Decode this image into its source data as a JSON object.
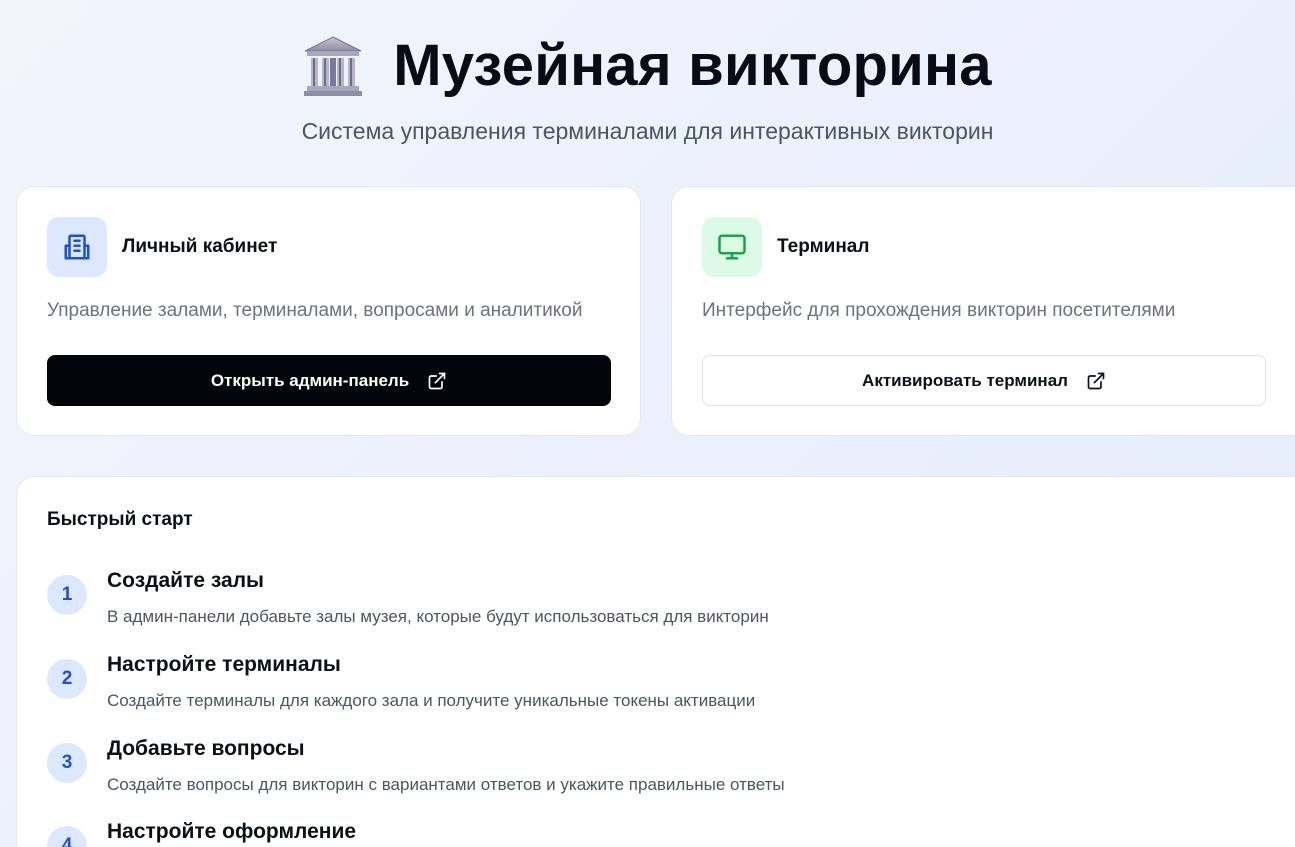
{
  "header": {
    "title": "Музейная викторина",
    "subtitle": "Система управления терминалами для интерактивных викторин",
    "icon": "museum-building-icon"
  },
  "cards": {
    "admin": {
      "icon": "building-document-icon",
      "title": "Личный кабинет",
      "description": "Управление залами, терминалами, вопросами и аналитикой",
      "button_label": "Открыть админ-панель",
      "button_icon": "external-link-icon",
      "accent": "#1d4fd8",
      "icon_bg": "#dbe8fd"
    },
    "terminal": {
      "icon": "monitor-icon",
      "title": "Терминал",
      "description": "Интерфейс для прохождения викторин посетителями",
      "button_label": "Активировать терминал",
      "button_icon": "external-link-icon",
      "accent": "#16a34a",
      "icon_bg": "#dcfbe6"
    }
  },
  "quick_start": {
    "title": "Быстрый старт",
    "steps": [
      {
        "number": "1",
        "title": "Создайте залы",
        "description": "В админ-панели добавьте залы музея, которые будут использоваться для викторин"
      },
      {
        "number": "2",
        "title": "Настройте терминалы",
        "description": "Создайте терминалы для каждого зала и получите уникальные токены активации"
      },
      {
        "number": "3",
        "title": "Добавьте вопросы",
        "description": "Создайте вопросы для викторин с вариантами ответов и укажите правильные ответы"
      },
      {
        "number": "4",
        "title": "Настройте оформление",
        "description": ""
      }
    ]
  },
  "colors": {
    "primary_button": "#03040c",
    "step_badge_bg": "#dbe8fd",
    "step_badge_text": "#1d4fd8"
  }
}
